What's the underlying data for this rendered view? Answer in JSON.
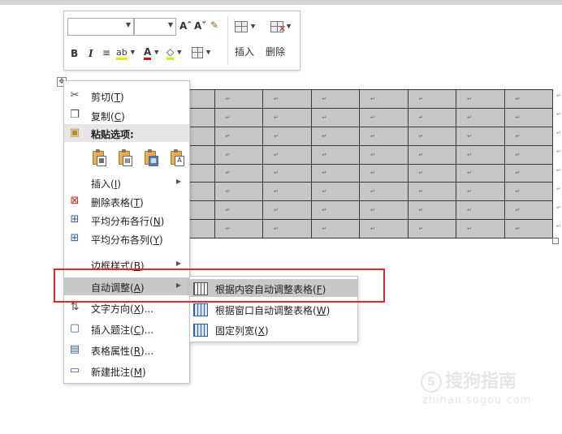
{
  "mini_toolbar": {
    "grow_font": "Aˆ",
    "shrink_font": "Aˇ",
    "bold": "B",
    "italic": "I",
    "insert_label": "插入",
    "delete_label": "删除"
  },
  "table": {
    "rows": 8,
    "cols": 10,
    "cell_mark": "↵",
    "move_handle": "✥"
  },
  "context_menu": {
    "cut": "剪切(T)",
    "copy": "复制(C)",
    "paste_options": "粘贴选项:",
    "insert": "插入(I)",
    "delete_table": "删除表格(T)",
    "distribute_rows": "平均分布各行(N)",
    "distribute_cols": "平均分布各列(Y)",
    "border_styles": "边框样式(B)",
    "autofit": "自动调整(A)",
    "text_direction": "文字方向(X)...",
    "insert_caption": "插入题注(C)...",
    "table_properties": "表格属性(R)...",
    "new_comment": "新建批注(M)"
  },
  "submenu": {
    "autofit_contents": "根据内容自动调整表格(F)",
    "autofit_window": "根据窗口自动调整表格(W)",
    "fixed_width": "固定列宽(X)"
  },
  "watermark": {
    "brand": "搜狗指南",
    "url": "zhinan.sogou.com"
  },
  "colors": {
    "highlight_box": "#e12727",
    "menu_highlight": "#c8c8c8",
    "table_fill": "#c6c6c6"
  }
}
